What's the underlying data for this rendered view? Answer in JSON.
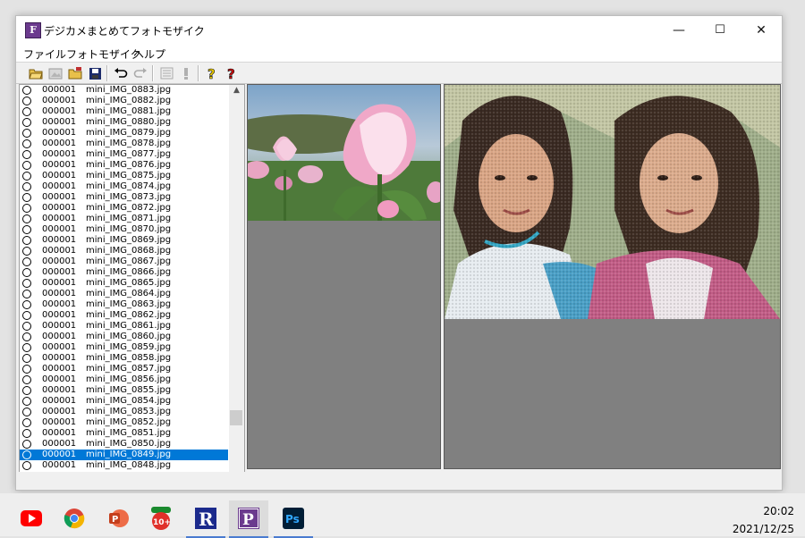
{
  "window": {
    "title": "デジカメまとめてフォトモザイク",
    "app_icon_letter": "F",
    "controls": {
      "minimize": "—",
      "maximize": "☐",
      "close": "✕"
    }
  },
  "menu": [
    "ファイル",
    "フォトモザイク",
    "ヘルプ"
  ],
  "toolbar": [
    "open-folder-icon",
    "image-icon",
    "folder-icon",
    "save-icon",
    "undo-icon",
    "redo-icon",
    "list-icon",
    "exclamation-icon",
    "help-icon",
    "context-help-icon"
  ],
  "file_list": {
    "rows": [
      {
        "count": "000001",
        "name": "mini_IMG_0883.jpg"
      },
      {
        "count": "000001",
        "name": "mini_IMG_0882.jpg"
      },
      {
        "count": "000001",
        "name": "mini_IMG_0881.jpg"
      },
      {
        "count": "000001",
        "name": "mini_IMG_0880.jpg"
      },
      {
        "count": "000001",
        "name": "mini_IMG_0879.jpg"
      },
      {
        "count": "000001",
        "name": "mini_IMG_0878.jpg"
      },
      {
        "count": "000001",
        "name": "mini_IMG_0877.jpg"
      },
      {
        "count": "000001",
        "name": "mini_IMG_0876.jpg"
      },
      {
        "count": "000001",
        "name": "mini_IMG_0875.jpg"
      },
      {
        "count": "000001",
        "name": "mini_IMG_0874.jpg"
      },
      {
        "count": "000001",
        "name": "mini_IMG_0873.jpg"
      },
      {
        "count": "000001",
        "name": "mini_IMG_0872.jpg"
      },
      {
        "count": "000001",
        "name": "mini_IMG_0871.jpg"
      },
      {
        "count": "000001",
        "name": "mini_IMG_0870.jpg"
      },
      {
        "count": "000001",
        "name": "mini_IMG_0869.jpg"
      },
      {
        "count": "000001",
        "name": "mini_IMG_0868.jpg"
      },
      {
        "count": "000001",
        "name": "mini_IMG_0867.jpg"
      },
      {
        "count": "000001",
        "name": "mini_IMG_0866.jpg"
      },
      {
        "count": "000001",
        "name": "mini_IMG_0865.jpg"
      },
      {
        "count": "000001",
        "name": "mini_IMG_0864.jpg"
      },
      {
        "count": "000001",
        "name": "mini_IMG_0863.jpg"
      },
      {
        "count": "000001",
        "name": "mini_IMG_0862.jpg"
      },
      {
        "count": "000001",
        "name": "mini_IMG_0861.jpg"
      },
      {
        "count": "000001",
        "name": "mini_IMG_0860.jpg"
      },
      {
        "count": "000001",
        "name": "mini_IMG_0859.jpg"
      },
      {
        "count": "000001",
        "name": "mini_IMG_0858.jpg"
      },
      {
        "count": "000001",
        "name": "mini_IMG_0857.jpg"
      },
      {
        "count": "000001",
        "name": "mini_IMG_0856.jpg"
      },
      {
        "count": "000001",
        "name": "mini_IMG_0855.jpg"
      },
      {
        "count": "000001",
        "name": "mini_IMG_0854.jpg"
      },
      {
        "count": "000001",
        "name": "mini_IMG_0853.jpg"
      },
      {
        "count": "000001",
        "name": "mini_IMG_0852.jpg"
      },
      {
        "count": "000001",
        "name": "mini_IMG_0851.jpg"
      },
      {
        "count": "000001",
        "name": "mini_IMG_0850.jpg"
      },
      {
        "count": "000001",
        "name": "mini_IMG_0849.jpg",
        "selected": true
      },
      {
        "count": "000001",
        "name": "mini_IMG_0848.jpg"
      }
    ]
  },
  "taskbar": {
    "apps": [
      "youtube-icon",
      "chrome-icon",
      "powerpoint-icon",
      "app-10plus-icon",
      "r-app-icon",
      "photomosaic-app-icon",
      "photoshop-icon"
    ],
    "labels": {
      "r": "R",
      "p": "P",
      "ps": "Ps",
      "ten": "10+"
    },
    "clock_time": "20:02",
    "clock_date": "2021/12/25"
  },
  "colors": {
    "selection": "#0078d7",
    "pane_bg": "#808080"
  }
}
